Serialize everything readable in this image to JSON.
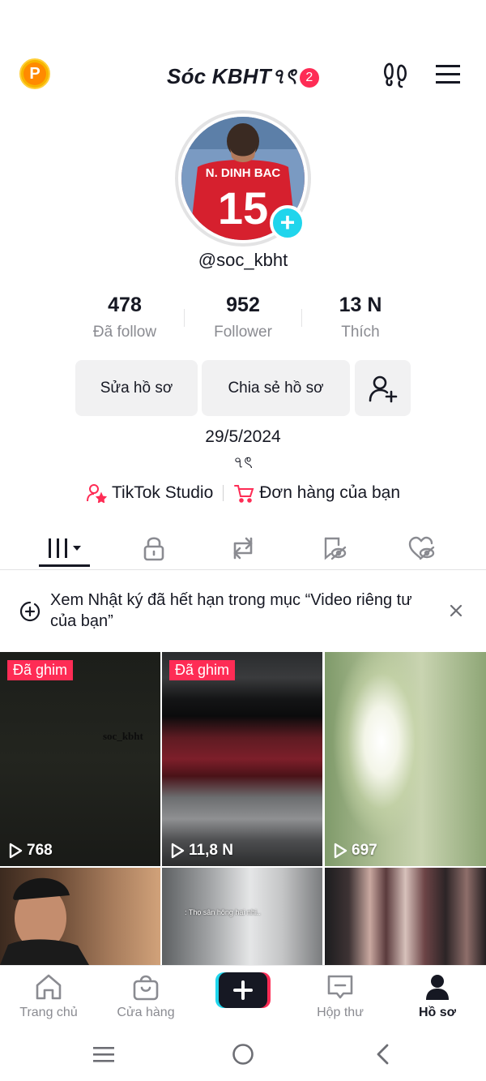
{
  "header": {
    "coin_letter": "P",
    "title": "Sóc KBHT৭ৎ",
    "notification_count": "2"
  },
  "profile": {
    "avatar_jersey_name": "N. DINH BAC",
    "avatar_jersey_number": "15",
    "username": "@soc_kbht",
    "stats": [
      {
        "value": "478",
        "label": "Đã follow"
      },
      {
        "value": "952",
        "label": "Follower"
      },
      {
        "value": "13 N",
        "label": "Thích"
      }
    ],
    "buttons": {
      "edit": "Sửa hồ sơ",
      "share": "Chia sẻ hồ sơ"
    },
    "date": "29/5/2024",
    "bio": "৭ৎ",
    "links": {
      "studio": "TikTok Studio",
      "orders": "Đơn hàng của bạn"
    }
  },
  "notice": {
    "text": "Xem Nhật ký đã hết hạn trong mục “Video riêng tư của bạn”"
  },
  "videos": [
    {
      "pinned": "Đã ghim",
      "views": "768",
      "overlay": "soc_kbht"
    },
    {
      "pinned": "Đã ghim",
      "views": "11,8 N"
    },
    {
      "views": "697"
    },
    {},
    {
      "overlay": ": Thọ sân hông hai nhi.."
    },
    {}
  ],
  "nav": {
    "home": "Trang chủ",
    "shop": "Cửa hàng",
    "inbox": "Hộp thư",
    "profile": "Hồ sơ"
  },
  "colors": {
    "accent": "#fe2c55",
    "cyan": "#20d5ec",
    "text": "#161823",
    "muted": "#8a8b91"
  }
}
